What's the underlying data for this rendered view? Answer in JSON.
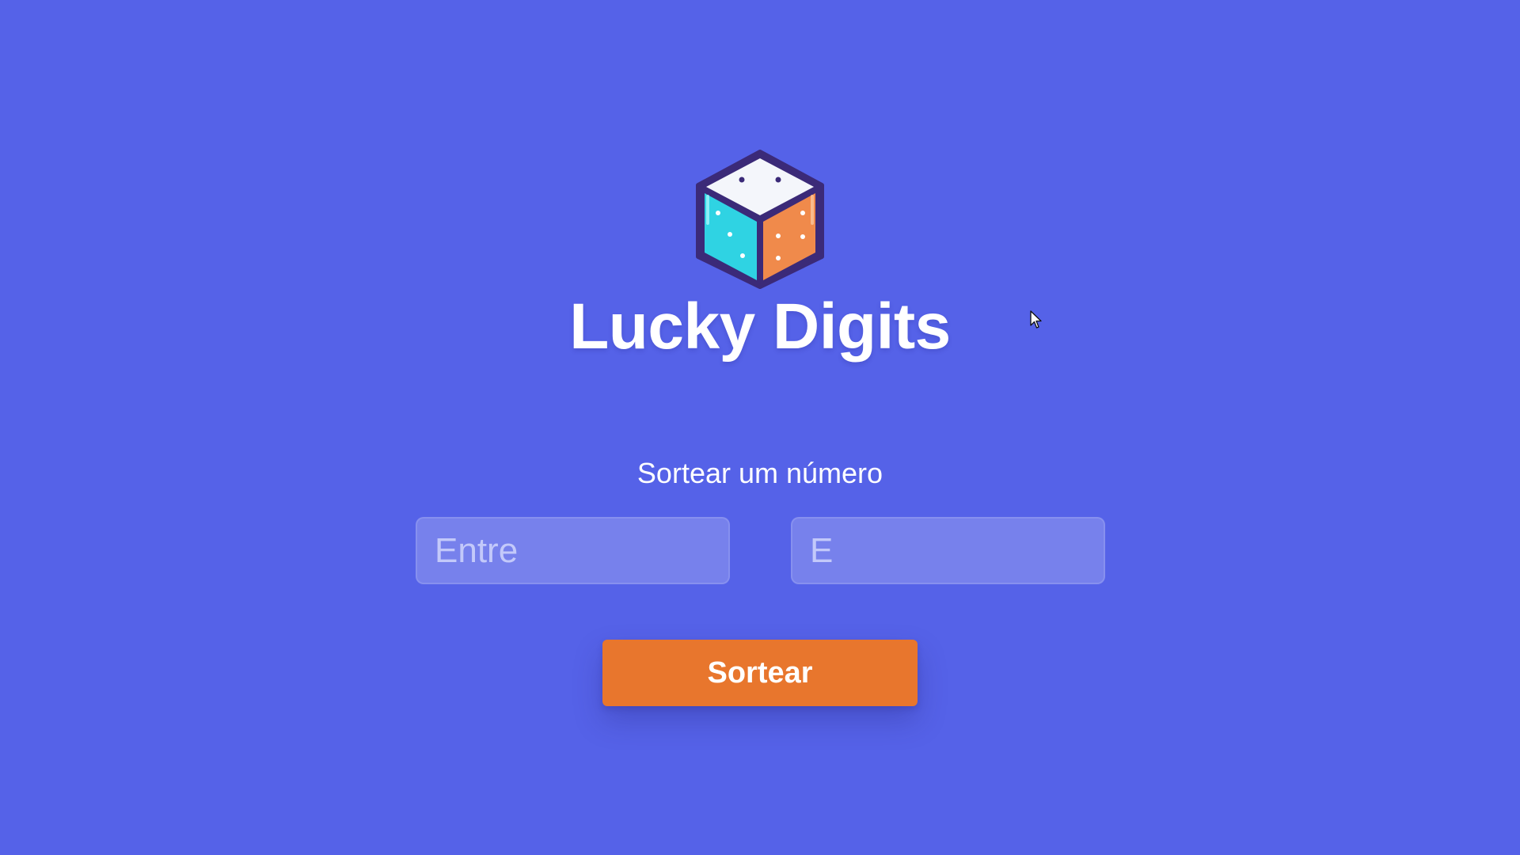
{
  "app": {
    "title": "Lucky Digits",
    "logo_icon": "dice-cube-icon"
  },
  "form": {
    "heading": "Sortear um número",
    "min_placeholder": "Entre",
    "max_placeholder": "E",
    "min_value": "",
    "max_value": "",
    "submit_label": "Sortear"
  },
  "colors": {
    "background": "#5562E8",
    "button": "#E8762D",
    "text": "#FFFFFF",
    "dice_top": "#F4F6FB",
    "dice_left": "#2FD3E3",
    "dice_right": "#F08A4B",
    "dice_outline": "#3B2A78"
  }
}
